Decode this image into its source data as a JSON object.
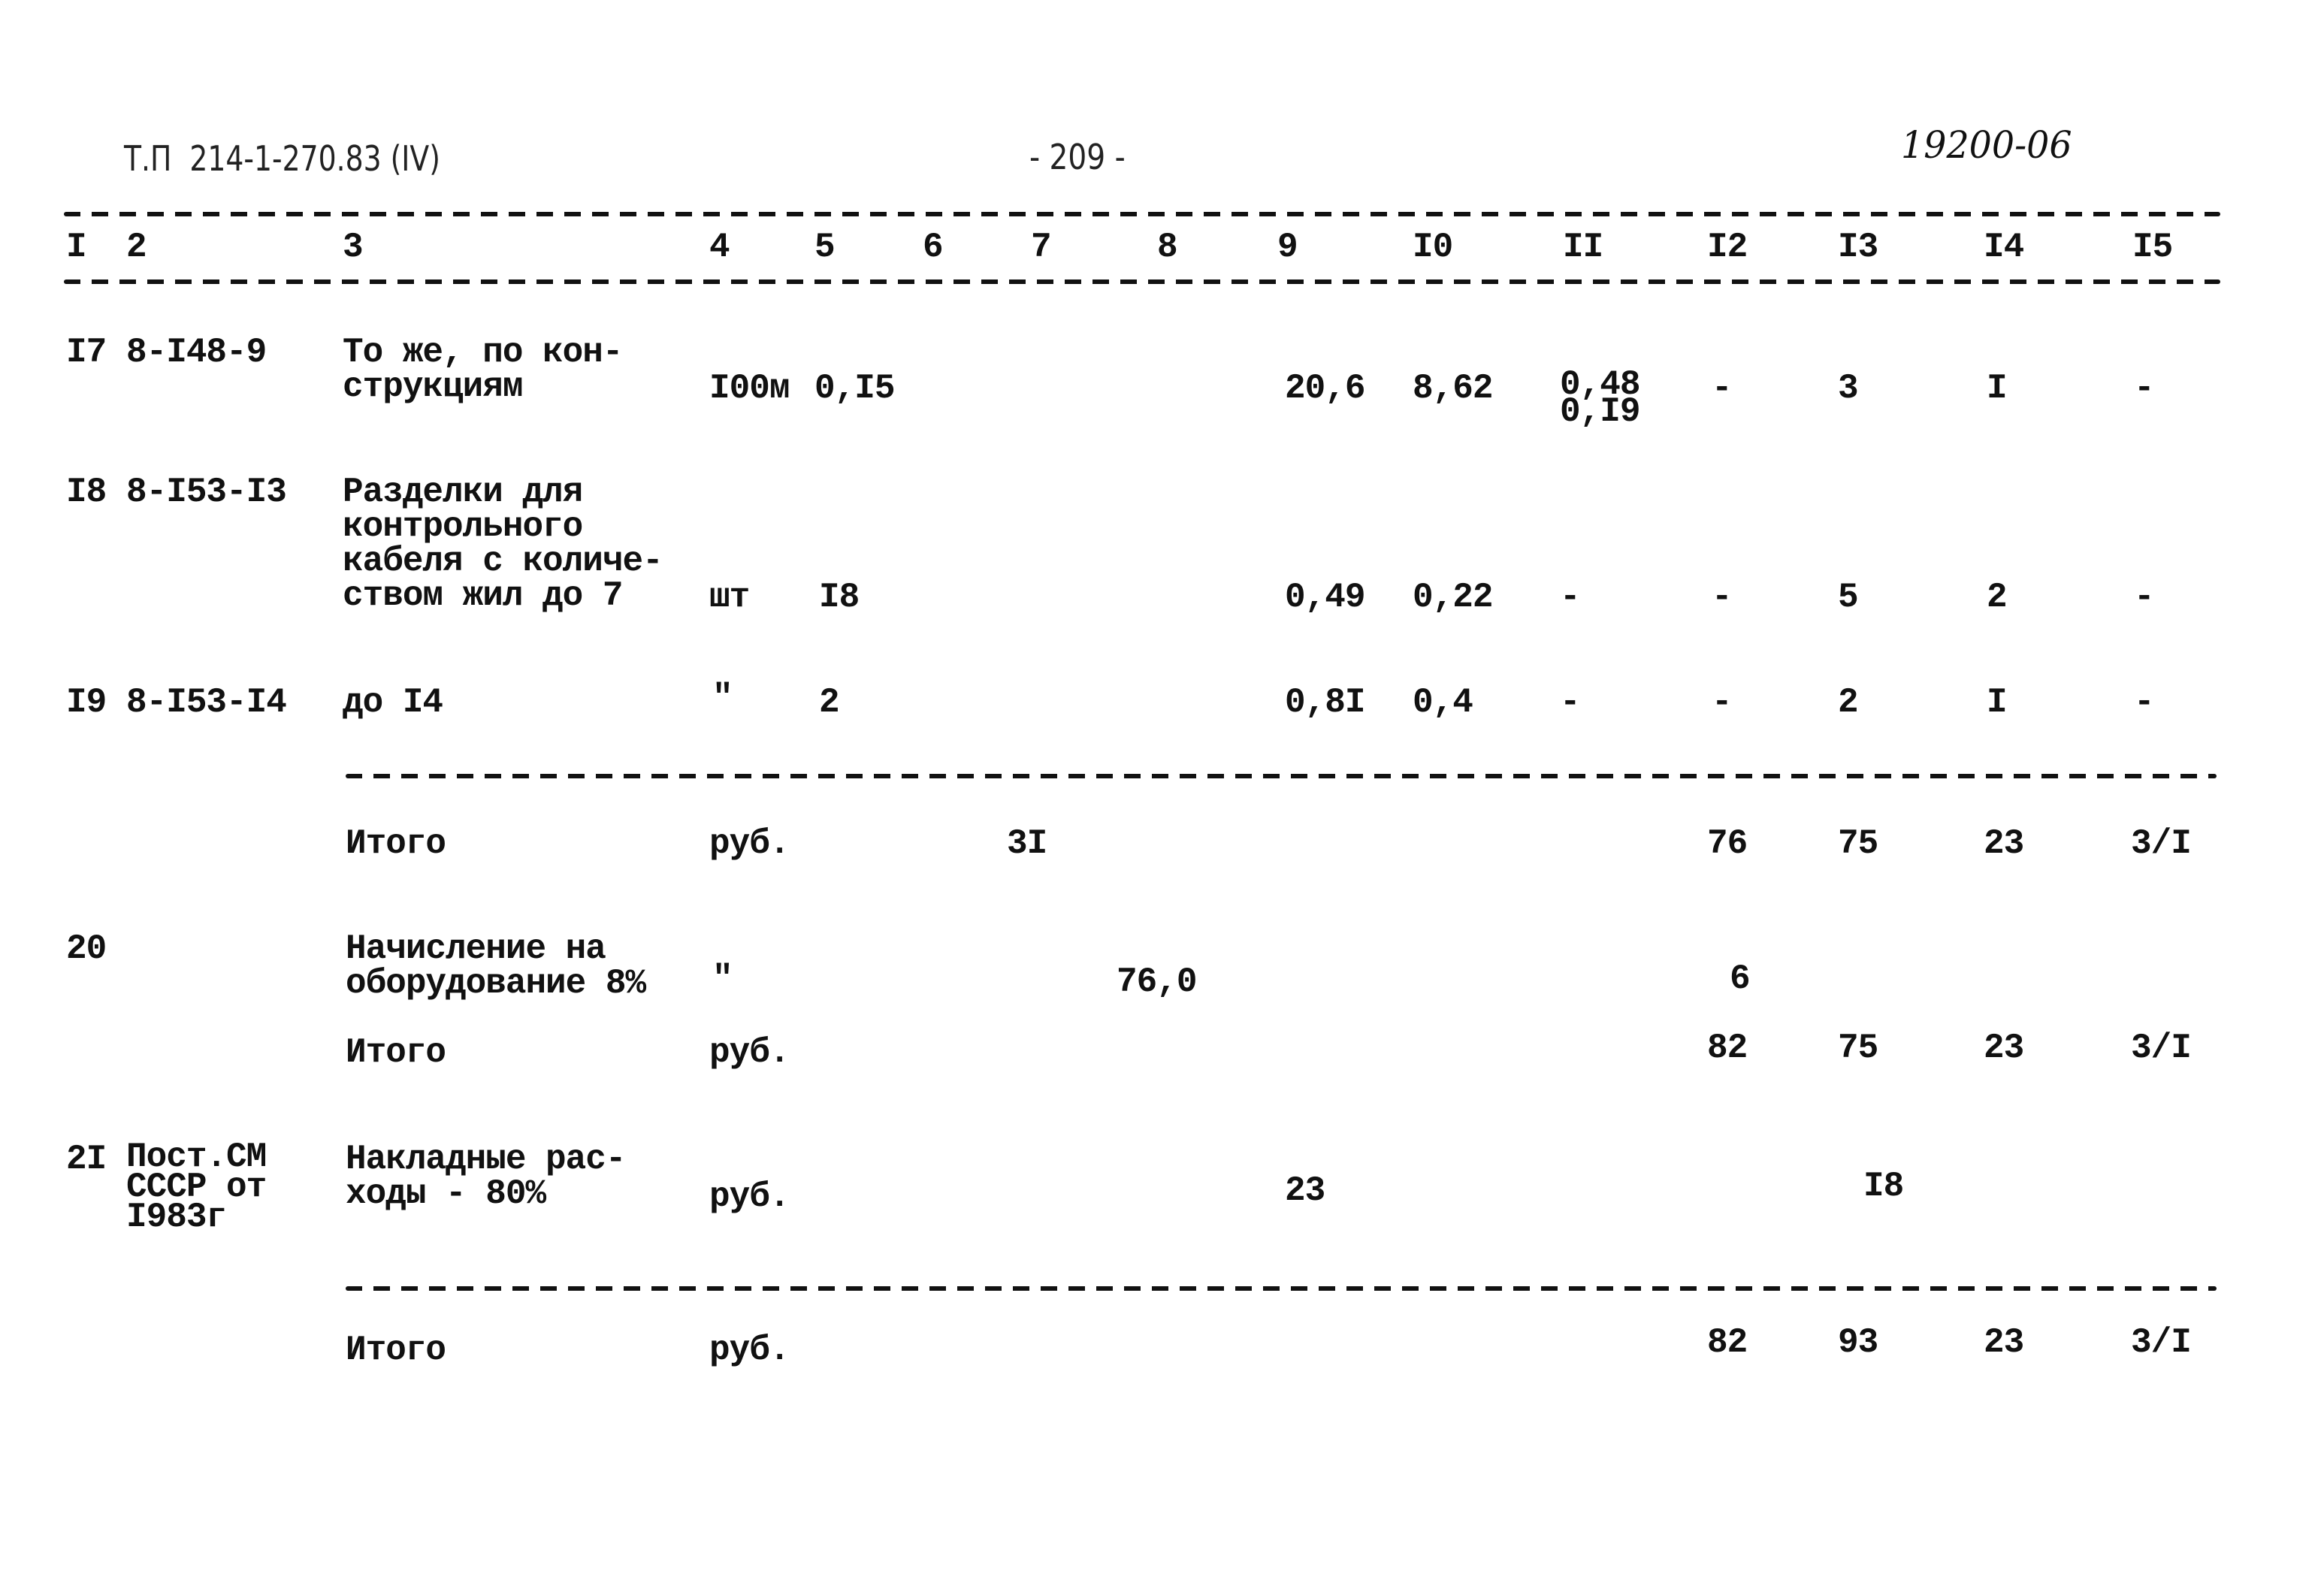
{
  "header": {
    "doc_ref": "Т.П  214-1-270.83 (IV)",
    "page_number": "- 209 -",
    "inventory_number": "19200-06"
  },
  "columns": [
    "I",
    "2",
    "3",
    "4",
    "5",
    "6",
    "7",
    "8",
    "9",
    "I0",
    "II",
    "I2",
    "I3",
    "I4",
    "I5"
  ],
  "rows": [
    {
      "num": "I7",
      "code": "8-I48-9",
      "name": "То же, по кон-\nструкциям",
      "unit": "I00м",
      "c5": "0,I5",
      "c9": "20,6",
      "c10": "8,62",
      "c11": "0,48\n0,I9",
      "c12": "-",
      "c13": "3",
      "c14": "I",
      "c15": "-"
    },
    {
      "num": "I8",
      "code": "8-I53-I3",
      "name": "Разделки для\nконтрольного\nкабеля с количе-\nством жил до 7",
      "unit": "шт",
      "c5": "I8",
      "c9": "0,49",
      "c10": "0,22",
      "c11": "-",
      "c12": "-",
      "c13": "5",
      "c14": "2",
      "c15": "-"
    },
    {
      "num": "I9",
      "code": "8-I53-I4",
      "name": "до I4",
      "unit": "\"",
      "c5": "2",
      "c9": "0,8I",
      "c10": "0,4",
      "c11": "-",
      "c12": "-",
      "c13": "2",
      "c14": "I",
      "c15": "-"
    }
  ],
  "total_1": {
    "label": "Итого",
    "unit": "руб.",
    "c7": "3I",
    "c12": "76",
    "c13": "75",
    "c14": "23",
    "c15": "3/I"
  },
  "row_20": {
    "num": "20",
    "name": "Начисление на\nоборудование 8%",
    "unit": "\"",
    "c8": "76,0",
    "c12": "6"
  },
  "total_2": {
    "label": "Итого",
    "unit": "руб.",
    "c12": "82",
    "c13": "75",
    "c14": "23",
    "c15": "3/I"
  },
  "row_21": {
    "num": "2I",
    "code": "Пост.СМ\nСССР от\nI983г",
    "name": "Накладные рас-\nходы - 80%",
    "unit": "руб.",
    "c9": "23",
    "c13": "I8"
  },
  "total_3": {
    "label": "Итого",
    "unit": "руб.",
    "c12": "82",
    "c13": "93",
    "c14": "23",
    "c15": "3/I"
  }
}
